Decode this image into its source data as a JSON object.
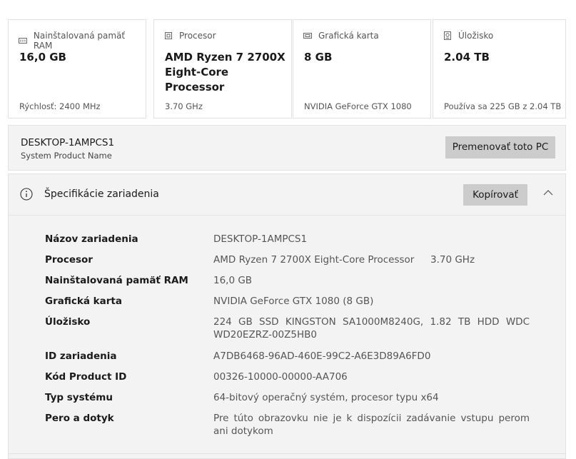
{
  "cards": [
    {
      "icon": "memory-icon",
      "label": "Nainštalovaná pamäť RAM",
      "value": "16,0 GB",
      "sub": "Rýchlosť: 2400 MHz"
    },
    {
      "icon": "processor-icon",
      "label": "Procesor",
      "value": "AMD Ryzen 7 2700X Eight-Core Processor",
      "sub": "3.70 GHz"
    },
    {
      "icon": "graphics-card-icon",
      "label": "Grafická karta",
      "value": "8 GB",
      "sub": "NVIDIA GeForce GTX 1080"
    },
    {
      "icon": "storage-icon",
      "label": "Úložisko",
      "value": "2.04 TB",
      "sub": "Používa sa 225 GB z 2.04 TB"
    }
  ],
  "pc": {
    "name": "DESKTOP-1AMPCS1",
    "model": "System Product Name",
    "rename_label": "Premenovať toto PC"
  },
  "specs_section": {
    "title": "Špecifikácie zariadenia",
    "copy_label": "Kopírovať",
    "rows": [
      {
        "key": "Názov zariadenia",
        "value": "DESKTOP-1AMPCS1"
      },
      {
        "key": "Procesor",
        "value": "AMD Ryzen 7 2700X Eight-Core Processor",
        "value2": "3.70 GHz"
      },
      {
        "key": "Nainštalovaná pamäť RAM",
        "value": "16,0 GB"
      },
      {
        "key": "Grafická karta",
        "value": "NVIDIA GeForce GTX 1080 (8 GB)"
      },
      {
        "key": "Úložisko",
        "value": "224 GB SSD KINGSTON SA1000M8240G, 1.82 TB HDD WDC WD20EZRZ-00Z5HB0"
      },
      {
        "key": "ID zariadenia",
        "value": "A7DB6468-96AD-460E-99C2-A6E3D89A6FD0"
      },
      {
        "key": "Kód Product ID",
        "value": "00326-10000-00000-AA706"
      },
      {
        "key": "Typ systému",
        "value": "64-bitový operačný systém, procesor typu x64"
      },
      {
        "key": "Pero a dotyk",
        "value": "Pre túto obrazovku nie je k dispozícii zadávanie vstupu perom ani dotykom"
      }
    ]
  }
}
